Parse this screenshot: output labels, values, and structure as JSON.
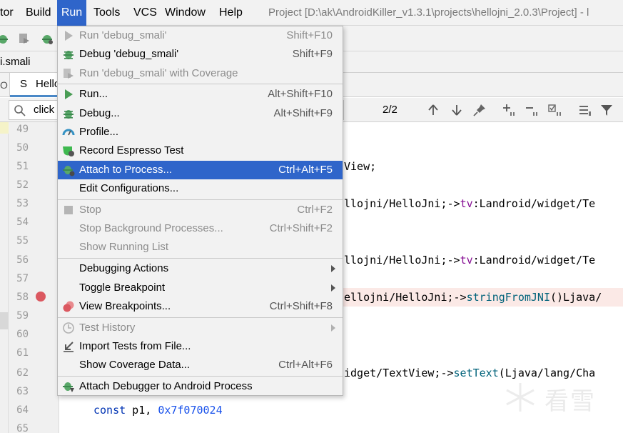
{
  "menubar": {
    "items": [
      {
        "label": "tor"
      },
      {
        "label": "Build"
      },
      {
        "label": "Run"
      },
      {
        "label": "Tools"
      },
      {
        "label": "VCS"
      },
      {
        "label": "Window"
      },
      {
        "label": "Help"
      }
    ],
    "title": "Project [D:\\ak\\AndroidKiller_v1.3.1\\projects\\hellojni_2.0.3\\Project] - l"
  },
  "file_tab": {
    "label": "i.smali"
  },
  "editor_tabs": {
    "left_stub": "O",
    "icon_letter": "S",
    "name": "Hello"
  },
  "search": {
    "value": "click",
    "match_count": "2/2"
  },
  "line_numbers": [
    "49",
    "50",
    "51",
    "52",
    "53",
    "54",
    "55",
    "56",
    "57",
    "58",
    "59",
    "60",
    "61",
    "62",
    "63",
    "64",
    "65"
  ],
  "code": {
    "l51": "View;",
    "l53_pre": "llojni/HelloJni;->",
    "l53_field": "tv",
    "l53_post": ":Landroid/widget/Te",
    "l56_pre": "llojni/HelloJni;->",
    "l56_field": "tv",
    "l56_post": ":Landroid/widget/Te",
    "l58_pre": "ellojni/HelloJni;->",
    "l58_fn": "stringFromJNI",
    "l58_post": "()Ljava/",
    "l62_pre": "idget/TextView;->",
    "l62_fn": "setText",
    "l62_post": "(Ljava/lang/Cha",
    "l64_kw": "const",
    "l64_reg": " p1, ",
    "l64_num": "0x7f070024"
  },
  "watermark": {
    "text": "看雪"
  },
  "run_menu": {
    "items": [
      {
        "label": "Run 'debug_smali'",
        "shortcut": "Shift+F10",
        "icon": "run-icon",
        "disabled": true
      },
      {
        "label": "Debug 'debug_smali'",
        "shortcut": "Shift+F9",
        "icon": "debug-bug-icon"
      },
      {
        "label": "Run 'debug_smali' with Coverage",
        "shortcut": "",
        "icon": "coverage-icon",
        "disabled": true
      },
      {
        "label": "Run...",
        "shortcut": "Alt+Shift+F10",
        "icon": "run-icon"
      },
      {
        "label": "Debug...",
        "shortcut": "Alt+Shift+F9",
        "icon": "debug-bug-icon"
      },
      {
        "label": "Profile...",
        "shortcut": "",
        "icon": "profile-gauge-icon"
      },
      {
        "label": "Record Espresso Test",
        "shortcut": "",
        "icon": "espresso-record-icon"
      },
      {
        "label": "Attach to Process...",
        "shortcut": "Ctrl+Alt+F5",
        "icon": "attach-bug-icon",
        "selected": true
      },
      {
        "label": "Edit Configurations...",
        "shortcut": ""
      },
      {
        "label": "Stop",
        "shortcut": "Ctrl+F2",
        "icon": "stop-icon",
        "disabled": true
      },
      {
        "label": "Stop Background Processes...",
        "shortcut": "Ctrl+Shift+F2",
        "disabled": true
      },
      {
        "label": "Show Running List",
        "shortcut": "",
        "disabled": true
      },
      {
        "label": "Debugging Actions",
        "shortcut": "",
        "submenu": true
      },
      {
        "label": "Toggle Breakpoint",
        "shortcut": "",
        "submenu": true
      },
      {
        "label": "View Breakpoints...",
        "shortcut": "Ctrl+Shift+F8",
        "icon": "breakpoints-icon"
      },
      {
        "label": "Test History",
        "shortcut": "",
        "icon": "history-clock-icon",
        "disabled": true,
        "submenu": true
      },
      {
        "label": "Import Tests from File...",
        "shortcut": "",
        "icon": "import-arrow-icon"
      },
      {
        "label": "Show Coverage Data...",
        "shortcut": "Ctrl+Alt+F6"
      },
      {
        "label": "Attach Debugger to Android Process",
        "shortcut": "",
        "icon": "android-attach-debugger-icon"
      }
    ]
  }
}
